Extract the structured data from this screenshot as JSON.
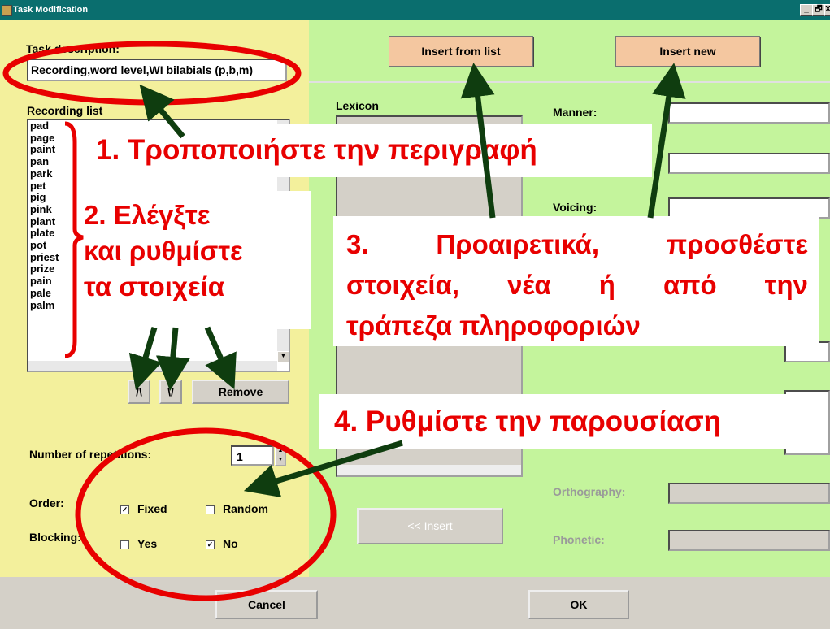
{
  "window": {
    "title": "Task Modification",
    "controls": [
      "_",
      "🗗",
      "X"
    ]
  },
  "left": {
    "task_description_label": "Task description:",
    "task_description_value": "Recording,word level,WI bilabials (p,b,m)",
    "recording_list_label": "Recording list",
    "recording_list_items": [
      "pad",
      "page",
      "paint",
      "pan",
      "park",
      "pet",
      "pig",
      "pink",
      "plant",
      "plate",
      "pot",
      "priest",
      "prize",
      "pain",
      "pale",
      "palm"
    ],
    "up_button": "/\\",
    "down_button": "\\/",
    "remove_button": "Remove",
    "repetitions_label": "Number of repetitions:",
    "repetitions_value": "1",
    "order_label": "Order:",
    "order_fixed": "Fixed",
    "order_random": "Random",
    "blocking_label": "Blocking:",
    "blocking_yes": "Yes",
    "blocking_no": "No"
  },
  "right": {
    "insert_from_list": "Insert from list",
    "insert_new": "Insert new",
    "lexicon_label": "Lexicon",
    "manner_label": "Manner:",
    "voicing_label": "Voicing:",
    "orthography_label": "Orthography:",
    "phonetic_label": "Phonetic:",
    "insert_button": "<< Insert"
  },
  "bottom": {
    "cancel": "Cancel",
    "ok": "OK"
  },
  "callouts": {
    "c1": "1. Τροποποιήστε την περιγραφή",
    "c2_line1": "2. Ελέγξτε",
    "c2_line2": "και ρυθμίστε",
    "c2_line3": "τα στοιχεία",
    "c3_line1": "3. Προαιρετικά, προσθέστε",
    "c3_line2": "στοιχεία, νέα ή από την",
    "c3_line3": "τράπεζα πληροφοριών",
    "c4": "4. Ρυθμίστε την παρουσίαση"
  },
  "colors": {
    "left_panel": "#f3f09c",
    "right_panel": "#c4f49c",
    "titlebar": "#0a6e6e",
    "annotation_red": "#e80000",
    "arrow_green": "#0f3d0f",
    "button_peach": "#f4c7a0"
  },
  "checkbox_state": {
    "order_fixed": true,
    "order_random": false,
    "blocking_yes": false,
    "blocking_no": true
  }
}
